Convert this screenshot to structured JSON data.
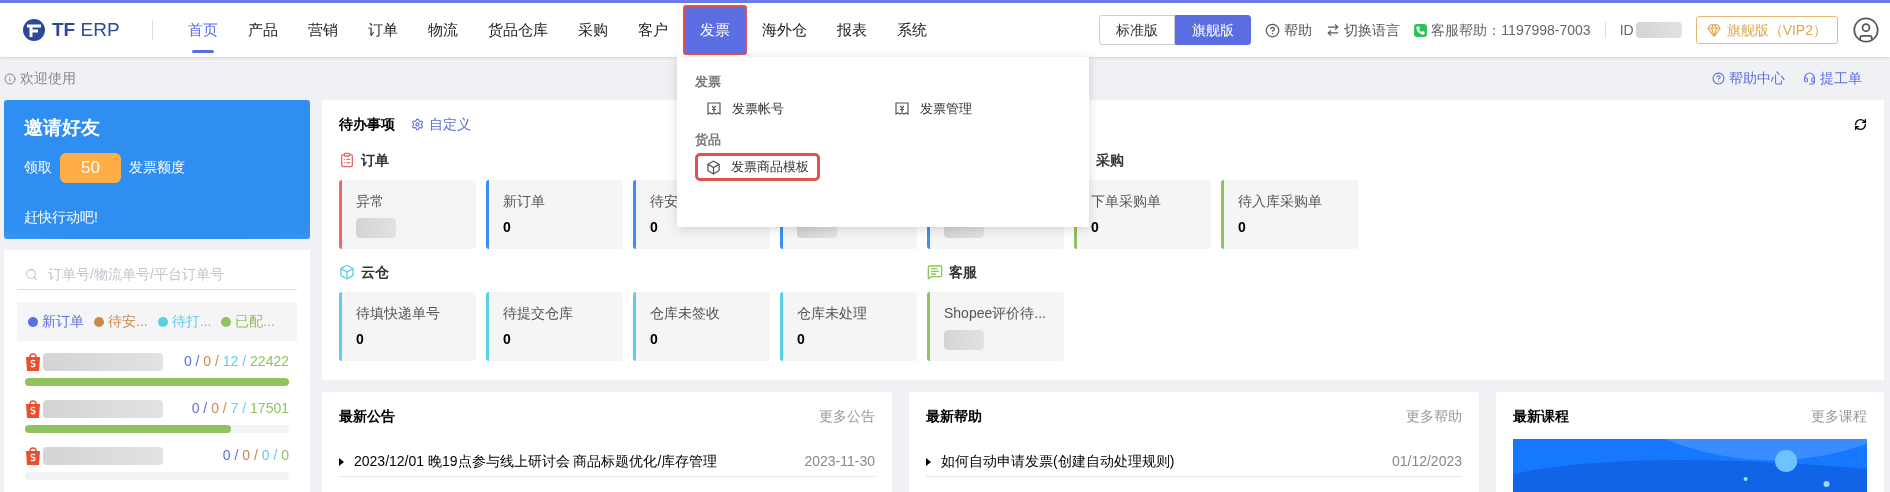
{
  "logo": {
    "text": "**TF** ERP"
  },
  "nav": [
    {
      "label": "首页",
      "selected": true,
      "open": false
    },
    {
      "label": "产品",
      "selected": false,
      "open": false
    },
    {
      "label": "营销",
      "selected": false,
      "open": false
    },
    {
      "label": "订单",
      "selected": false,
      "open": false
    },
    {
      "label": "物流",
      "selected": false,
      "open": false
    },
    {
      "label": "货品仓库",
      "selected": false,
      "open": false
    },
    {
      "label": "采购",
      "selected": false,
      "open": false
    },
    {
      "label": "客户",
      "selected": false,
      "open": false
    },
    {
      "label": "发票",
      "selected": false,
      "open": true
    },
    {
      "label": "海外仓",
      "selected": false,
      "open": false
    },
    {
      "label": "报表",
      "selected": false,
      "open": false
    },
    {
      "label": "系统",
      "selected": false,
      "open": false
    }
  ],
  "edition_toggle": [
    {
      "label": "标准版",
      "selected": false
    },
    {
      "label": "旗舰版",
      "selected": true
    }
  ],
  "header_links": {
    "help": "帮助",
    "language": "切换语言",
    "support": "客服帮助：1197998-7003",
    "id_label": "ID",
    "vip": "旗舰版（VIP2）"
  },
  "dropdown": {
    "groups": [
      {
        "title": "发票",
        "items": [
          {
            "label": "发票帐号",
            "kind": "receipt",
            "highlighted": false
          },
          {
            "label": "发票管理",
            "kind": "receipt",
            "highlighted": false
          }
        ]
      },
      {
        "title": "货品",
        "items": [
          {
            "label": "发票商品模板",
            "kind": "box",
            "highlighted": true
          }
        ]
      }
    ]
  },
  "sub_bar": {
    "welcome": "欢迎使用",
    "help_center": "帮助中心",
    "ticket": "提工单"
  },
  "invite": {
    "title": "邀请好友",
    "prefix": "领取",
    "amount": "50",
    "suffix": "发票额度",
    "cta": "赶快行动吧!"
  },
  "order_search": {
    "placeholder": "订单号/物流单号/平台订单号"
  },
  "legend": [
    {
      "label": "新订单",
      "color": "#5b6ee1"
    },
    {
      "label": "待安...",
      "color": "#c98a4b"
    },
    {
      "label": "待打...",
      "color": "#5bcfe6"
    },
    {
      "label": "已配...",
      "color": "#8fc35b"
    }
  ],
  "stores": [
    {
      "counts": [
        "0 / ",
        "0 / ",
        "12 / ",
        "22422"
      ],
      "level": 1
    },
    {
      "counts": [
        "0 / ",
        "0 / ",
        "7 / ",
        "17501"
      ],
      "level": 0.78
    },
    {
      "counts": [
        "0 / ",
        "0 / ",
        "0 / ",
        "0"
      ],
      "level": 0
    }
  ],
  "todo": {
    "title": "待办事项",
    "customize": "自定义",
    "rows": [
      [
        {
          "title": "订单",
          "kind": "order",
          "cards": [
            {
              "label": "异常",
              "blurred": true,
              "color": "#e86a6a"
            },
            {
              "label": "新订单",
              "value": "0",
              "blurred": false,
              "color": "#3d8ef7"
            },
            {
              "label": "待安",
              "value": "0",
              "blurred": false,
              "color": "#3d8ef7"
            },
            {
              "blurred": true,
              "color": "#3d8ef7"
            },
            {
              "blurred": true,
              "color": "#3d8ef7"
            }
          ]
        },
        {
          "title": "采购",
          "kind": "purchase",
          "cards": [
            {
              "label": "下单采购单",
              "value": "0",
              "blurred": false,
              "color": "#8fc35b"
            },
            {
              "label": "待入库采购单",
              "value": "0",
              "blurred": false,
              "color": "#8fc35b"
            }
          ]
        }
      ],
      [
        {
          "title": "云仓",
          "kind": "cloud",
          "cards": [
            {
              "label": "待填快递单号",
              "value": "0",
              "blurred": false,
              "color": "#5bcfe6"
            },
            {
              "label": "待提交仓库",
              "value": "0",
              "blurred": false,
              "color": "#5bcfe6"
            },
            {
              "label": "仓库未签收",
              "value": "0",
              "blurred": false,
              "color": "#5bcfe6"
            },
            {
              "label": "仓库未处理",
              "value": "0",
              "blurred": false,
              "color": "#5bcfe6"
            }
          ]
        },
        {
          "title": "客服",
          "kind": "service",
          "cards": [
            {
              "label": "Shopee评价待...",
              "blurred": true,
              "color": "#8fc35b"
            }
          ]
        }
      ]
    ]
  },
  "panels": [
    {
      "title": "最新公告",
      "more": "更多公告",
      "items": [
        {
          "text": "2023/12/01 晚19点参与线上研讨会 商品标题优化/库存管理",
          "date": "2023-11-30"
        }
      ]
    },
    {
      "title": "最新帮助",
      "more": "更多帮助",
      "items": [
        {
          "text": "如何自动申请发票(创建自动处理规则)",
          "date": "01/12/2023"
        }
      ]
    },
    {
      "title": "最新课程",
      "more": "更多课程",
      "kind": "picture"
    }
  ]
}
